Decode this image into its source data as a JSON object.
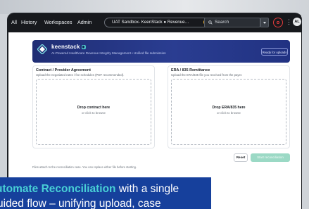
{
  "nav": {
    "items": [
      "All",
      "History",
      "Workspaces",
      "Admin"
    ],
    "environment": "UAT Sandbox- KeenStack ● Revenue…",
    "search_placeholder": "Search",
    "avatar_initials": "AL"
  },
  "hero": {
    "brand": "keenstack",
    "subtitle": "AI-Powered Healthcare Revenue Integrity Management • Unified file submission",
    "badge": "Ready for uploads"
  },
  "contract_card": {
    "title": "Contract / Provider Agreement",
    "subtitle": "Upload the negotiated rates / fee schedules (PDF recommended).",
    "drop_title": "Drop contract here",
    "drop_sub": "or click to browse"
  },
  "era_card": {
    "title": "ERA / 835 Remittance",
    "subtitle": "Upload the ERA/835 file you received from the payer.",
    "drop_title": "Drop ERA/835 here",
    "drop_sub": "or click to browse"
  },
  "actions": {
    "reset": "Reset",
    "start": "Start reconciliation"
  },
  "footnote": "Files attach to the reconciliation case. You can replace either file before starting.",
  "banner": {
    "highlight": "utomate Reconciliation",
    "rest1": " with a single",
    "line2": "uided flow – unifying upload, case"
  },
  "colors": {
    "topbar": "#17191d",
    "hero": "#2a3d91",
    "accent": "#48cfd6",
    "start_button": "#9bd9c5",
    "banner": "#16409c"
  }
}
